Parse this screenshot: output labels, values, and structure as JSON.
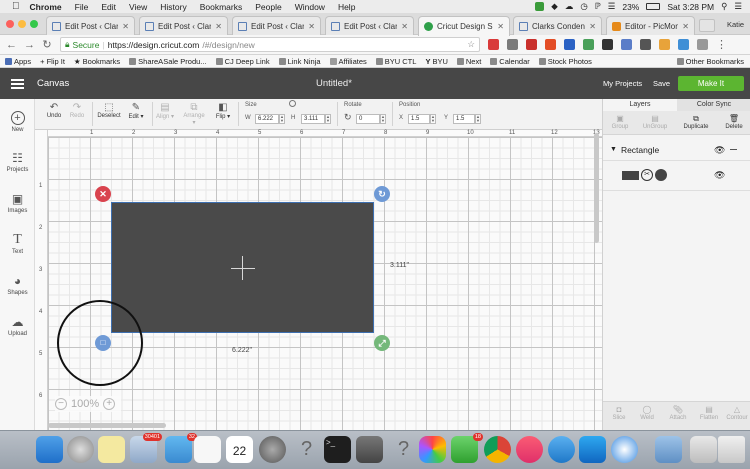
{
  "menubar": {
    "app": "Chrome",
    "items": [
      "File",
      "Edit",
      "View",
      "History",
      "Bookmarks",
      "People",
      "Window",
      "Help"
    ],
    "battery": "23%",
    "clock": "Sat 3:28 PM"
  },
  "tabs": [
    {
      "title": "Edit Post ‹ Clarks",
      "icon": "wordpress-icon"
    },
    {
      "title": "Edit Post ‹ Clarks",
      "icon": "wordpress-icon"
    },
    {
      "title": "Edit Post ‹ Clarks",
      "icon": "wordpress-icon"
    },
    {
      "title": "Edit Post ‹ Clarks",
      "icon": "wordpress-icon"
    },
    {
      "title": "Cricut Design Spa",
      "icon": "cricut-icon",
      "active": true
    },
    {
      "title": "Clarks Condensed",
      "icon": "wordpress-icon"
    },
    {
      "title": "Editor - PicMonke",
      "icon": "picmonkey-icon"
    }
  ],
  "profile_name": "Katie",
  "address": {
    "secure_label": "Secure",
    "url_host": "https://design.cricut.com",
    "url_path": "/#/design/new"
  },
  "bookmarks": {
    "items": [
      "Apps",
      "+ Flip It",
      "Bookmarks",
      "ShareASale Produ...",
      "CJ Deep Link",
      "Link Ninja",
      "Affiliates",
      "BYU CTL",
      "BYU",
      "Next",
      "Calendar",
      "Stock Photos"
    ],
    "other": "Other Bookmarks"
  },
  "header": {
    "section": "Canvas",
    "doc_title": "Untitled*",
    "my_projects": "My Projects",
    "save": "Save",
    "make_it": "Make It"
  },
  "toolbar": {
    "undo": "Undo",
    "redo": "Redo",
    "deselect": "Deselect",
    "edit": "Edit",
    "align": "Align",
    "arrange": "Arrange",
    "flip": "Flip",
    "size_label": "Size",
    "w_label": "W",
    "w_value": "6.222",
    "h_label": "H",
    "h_value": "3.111",
    "rotate_label": "Rotate",
    "rotate_value": "0",
    "position_label": "Position",
    "x_label": "X",
    "x_value": "1.5",
    "y_label": "Y",
    "y_value": "1.5"
  },
  "left_panel": [
    {
      "label": "New",
      "icon": "plus-icon"
    },
    {
      "label": "Projects",
      "icon": "projects-icon"
    },
    {
      "label": "Images",
      "icon": "image-icon"
    },
    {
      "label": "Text",
      "icon": "text-icon"
    },
    {
      "label": "Shapes",
      "icon": "shapes-icon"
    },
    {
      "label": "Upload",
      "icon": "upload-icon"
    }
  ],
  "ruler": {
    "top": [
      "1",
      "2",
      "3",
      "4",
      "5",
      "6",
      "7",
      "8",
      "9",
      "10",
      "11",
      "12",
      "13"
    ],
    "left": [
      "1",
      "2",
      "3",
      "4",
      "5",
      "6"
    ]
  },
  "canvas": {
    "width_dim": "6.222\"",
    "height_dim": "3.111\"",
    "zoom": "100%",
    "zoom_out": "−",
    "zoom_in": "+"
  },
  "right_panel": {
    "tab_layers": "Layers",
    "tab_color_sync": "Color Sync",
    "actions": [
      "Group",
      "UnGroup",
      "Duplicate",
      "Delete"
    ],
    "layer_name": "Rectangle",
    "bottom_actions": [
      "Slice",
      "Weld",
      "Attach",
      "Flatten",
      "Contour"
    ]
  },
  "dock": {
    "mail_badge": "30401",
    "messages_badge": "32",
    "calendar_day": "22",
    "facetime_badge": "18"
  }
}
